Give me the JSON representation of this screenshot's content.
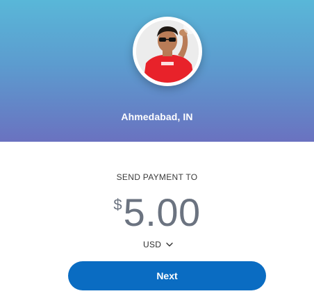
{
  "header": {
    "location": "Ahmedabad, IN",
    "gradient_top": "#59b7d8",
    "gradient_bottom": "#6a72c0"
  },
  "avatar": {
    "icon": "profile-photo"
  },
  "payment": {
    "label": "SEND PAYMENT TO",
    "currency_symbol": "$",
    "amount": "5.00",
    "currency": "USD",
    "currency_icon": "chevron-down-icon"
  },
  "actions": {
    "next_label": "Next",
    "button_color": "#0a6cc2"
  }
}
